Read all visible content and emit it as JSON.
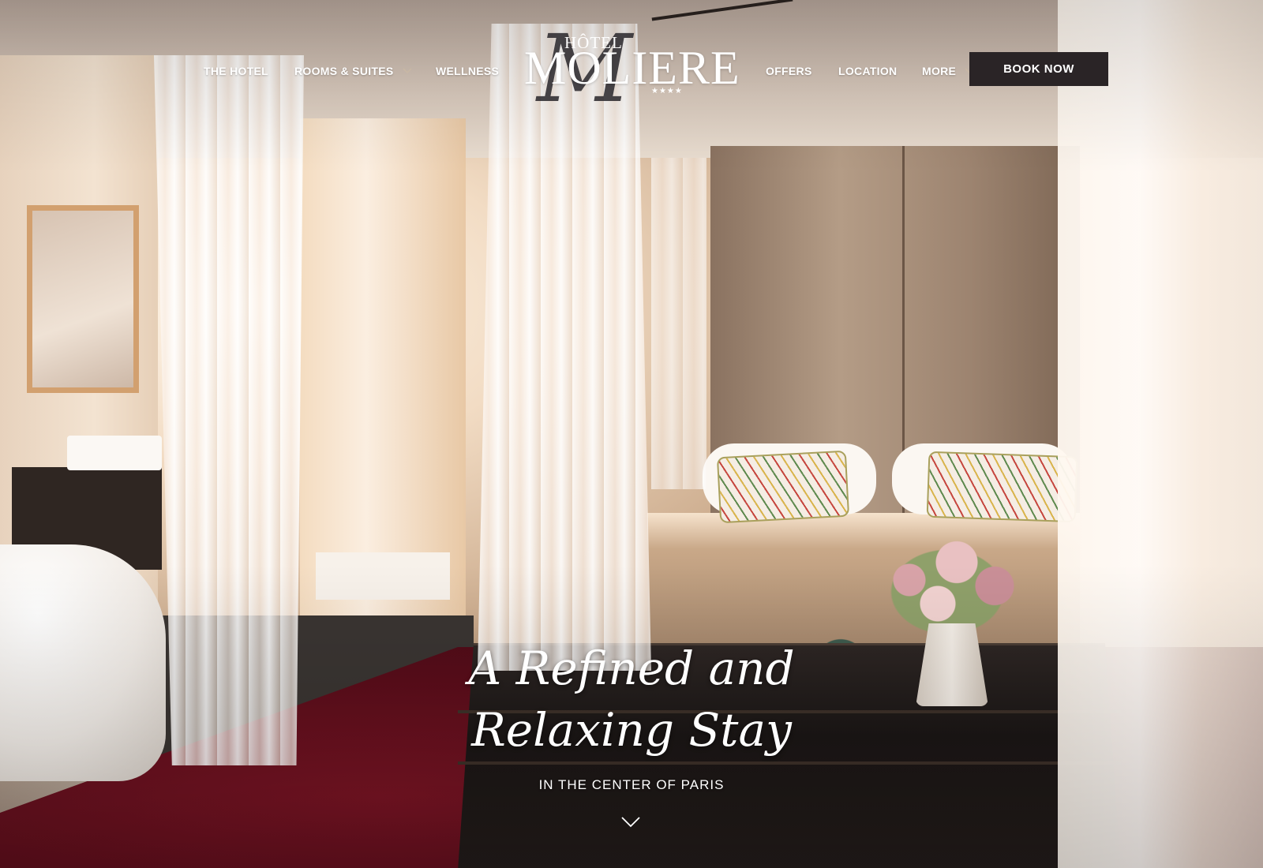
{
  "nav": {
    "left_items": [
      {
        "label": "THE HOTEL"
      },
      {
        "label": "ROOMS & SUITES",
        "has_dropdown": true
      },
      {
        "label": "WELLNESS"
      }
    ],
    "right_items": [
      {
        "label": "OFFERS"
      },
      {
        "label": "LOCATION"
      },
      {
        "label": "MORE",
        "has_dropdown": true
      }
    ],
    "book_button": "BOOK NOW"
  },
  "logo": {
    "line1": "HÔTEL",
    "name": "MOLIERE",
    "stars": "★★★★",
    "monogram": "M"
  },
  "hero": {
    "headline": "A Refined and Relaxing Stay",
    "subheadline": "IN THE CENTER OF PARIS",
    "scroll_icon": "chevron-down-icon"
  },
  "colors": {
    "button_bg": "#2a2426",
    "text": "#ffffff",
    "chevron": "#c9b8a4"
  }
}
